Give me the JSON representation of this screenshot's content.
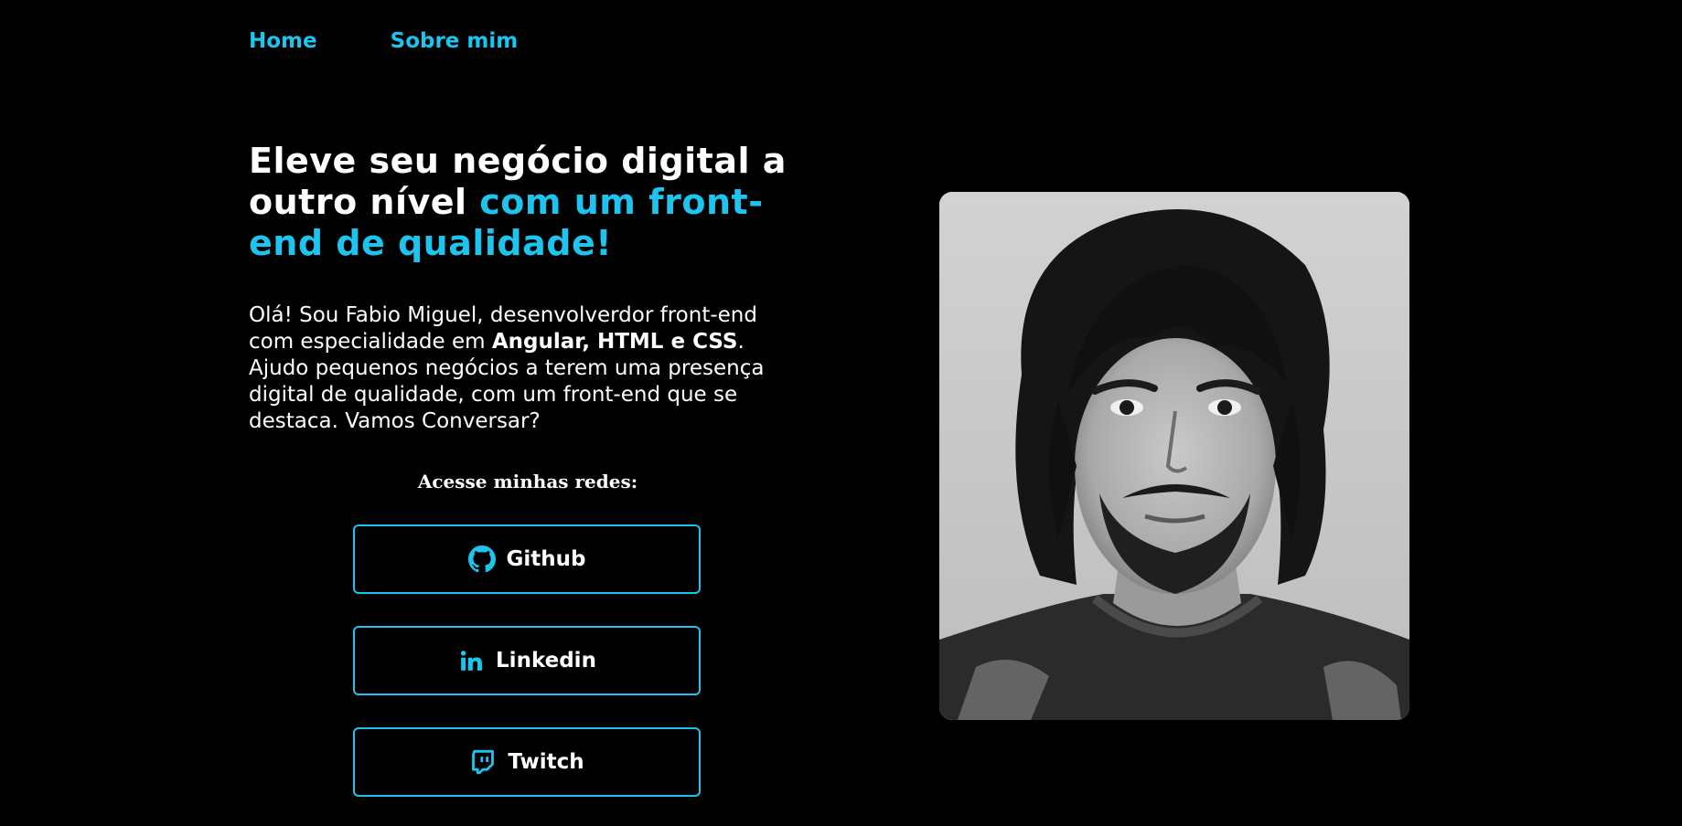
{
  "nav": {
    "items": [
      {
        "label": "Home"
      },
      {
        "label": "Sobre mim"
      }
    ]
  },
  "hero": {
    "headline_white": "Eleve seu negócio digital a outro nível ",
    "headline_accent": "com um front-end de qualidade!",
    "intro_before": "Olá! Sou Fabio Miguel, desenvolverdor front-end com especialidade em ",
    "intro_bold": "Angular, HTML e CSS",
    "intro_after": ". Ajudo pequenos negócios a terem uma presença digital de qualidade, com um front-end que se destaca. Vamos Conversar?"
  },
  "social": {
    "title": "Acesse minhas redes:",
    "buttons": [
      {
        "label": "Github",
        "icon": "github-icon"
      },
      {
        "label": "Linkedin",
        "icon": "linkedin-icon"
      },
      {
        "label": "Twitch",
        "icon": "twitch-icon"
      }
    ]
  },
  "photo": {
    "alt": "profile-photo"
  },
  "colors": {
    "background": "#000000",
    "accent": "#1cc4ee",
    "text": "#ffffff"
  }
}
